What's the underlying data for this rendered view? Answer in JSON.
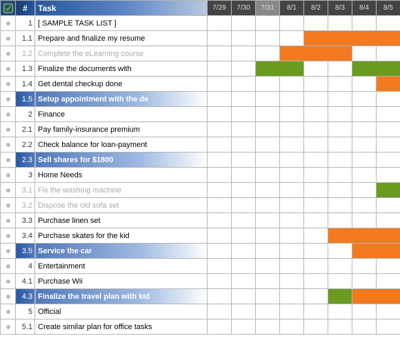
{
  "colors": {
    "bar_orange": "#f47a1f",
    "bar_green": "#6a9b1f"
  },
  "header": {
    "check_icon": "✓",
    "num_label": "#",
    "task_label": "Task",
    "dates": [
      "7/29",
      "7/30",
      "7/31",
      "8/1",
      "8/2",
      "8/3",
      "8/4",
      "8/5"
    ],
    "today_index": 2
  },
  "rows": [
    {
      "num": "1",
      "task": "[ SAMPLE TASK LIST ]",
      "type": "cat",
      "bars": []
    },
    {
      "num": "1.1",
      "task": "Prepare and finalize my resume",
      "type": "norm",
      "bars": [
        {
          "col": 4,
          "span": 4,
          "c": "o"
        }
      ]
    },
    {
      "num": "1.2",
      "task": "Complete the eLearning course",
      "type": "dim",
      "bars": [
        {
          "col": 3,
          "span": 3,
          "c": "o"
        }
      ]
    },
    {
      "num": "1.3",
      "task": "Finalize the documents with",
      "type": "norm",
      "bars": [
        {
          "col": 2,
          "span": 2,
          "c": "g"
        },
        {
          "col": 6,
          "span": 2,
          "c": "g"
        }
      ]
    },
    {
      "num": "1.4",
      "task": "Get dental checkup done",
      "type": "norm",
      "bars": [
        {
          "col": 7,
          "span": 1,
          "c": "o"
        }
      ]
    },
    {
      "num": "1.5",
      "task": "Setup appointment with the de",
      "type": "hl",
      "bars": []
    },
    {
      "num": "2",
      "task": "Finance",
      "type": "cat",
      "bars": []
    },
    {
      "num": "2.1",
      "task": "Pay family-insurance premium",
      "type": "norm",
      "bars": []
    },
    {
      "num": "2.2",
      "task": "Check balance for loan-payment",
      "type": "norm",
      "bars": []
    },
    {
      "num": "2.3",
      "task": "Sell shares for $1800",
      "type": "hl",
      "bars": []
    },
    {
      "num": "3",
      "task": "Home Needs",
      "type": "cat",
      "bars": []
    },
    {
      "num": "3.1",
      "task": "Fix the washing machine",
      "type": "dim",
      "bars": [
        {
          "col": 7,
          "span": 1,
          "c": "g"
        }
      ]
    },
    {
      "num": "3.2",
      "task": "Dispose the old sofa set",
      "type": "dim",
      "bars": []
    },
    {
      "num": "3.3",
      "task": "Purchase linen set",
      "type": "norm",
      "bars": []
    },
    {
      "num": "3.4",
      "task": "Purchase skates for the kid",
      "type": "norm",
      "bars": [
        {
          "col": 5,
          "span": 3,
          "c": "o"
        }
      ]
    },
    {
      "num": "3.5",
      "task": "Service the car",
      "type": "hl",
      "bars": [
        {
          "col": 6,
          "span": 2,
          "c": "o"
        }
      ]
    },
    {
      "num": "4",
      "task": "Entertainment",
      "type": "cat",
      "bars": []
    },
    {
      "num": "4.1",
      "task": "Purchase Wii",
      "type": "norm",
      "bars": []
    },
    {
      "num": "4.3",
      "task": "Finalize the travel plan with kid",
      "type": "hl",
      "bars": [
        {
          "col": 5,
          "span": 1,
          "c": "g"
        },
        {
          "col": 6,
          "span": 2,
          "c": "o"
        }
      ]
    },
    {
      "num": "5",
      "task": "Official",
      "type": "cat",
      "bars": []
    },
    {
      "num": "5.1",
      "task": "Create similar plan for office tasks",
      "type": "norm",
      "bars": []
    }
  ]
}
